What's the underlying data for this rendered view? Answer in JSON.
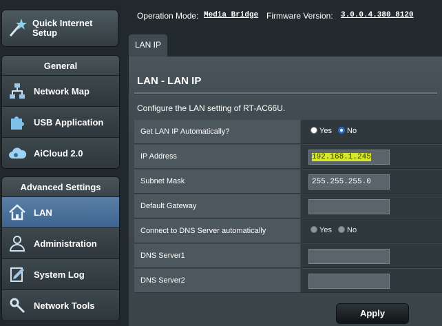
{
  "sidebar": {
    "quick_setup_label": "Quick Internet Setup",
    "general": {
      "title": "General",
      "items": [
        {
          "label": "Network Map",
          "icon": "network-map-icon"
        },
        {
          "label": "USB Application",
          "icon": "puzzle-icon"
        },
        {
          "label": "AiCloud 2.0",
          "icon": "cloud-icon"
        }
      ]
    },
    "advanced": {
      "title": "Advanced Settings",
      "items": [
        {
          "label": "LAN",
          "icon": "home-icon",
          "active": true
        },
        {
          "label": "Administration",
          "icon": "person-icon"
        },
        {
          "label": "System Log",
          "icon": "log-icon"
        },
        {
          "label": "Network Tools",
          "icon": "wrench-icon"
        }
      ]
    }
  },
  "topbar": {
    "op_mode_label": "Operation Mode:",
    "op_mode_value": "Media Bridge",
    "firmware_label": "Firmware Version:",
    "firmware_value": "3.0.0.4.380_8120"
  },
  "tabs": [
    {
      "label": "LAN IP",
      "active": true
    }
  ],
  "panel": {
    "title": "LAN - LAN IP",
    "description": "Configure the LAN setting of RT-AC66U.",
    "fields": {
      "auto_ip": {
        "label": "Get LAN IP Automatically?",
        "yes": "Yes",
        "no": "No",
        "selected": "No"
      },
      "ip_address": {
        "label": "IP Address",
        "value": "192.168.1.245"
      },
      "subnet_mask": {
        "label": "Subnet Mask",
        "value": "255.255.255.0"
      },
      "default_gateway": {
        "label": "Default Gateway",
        "value": ""
      },
      "dns_auto": {
        "label": "Connect to DNS Server automatically",
        "yes": "Yes",
        "no": "No"
      },
      "dns1": {
        "label": "DNS Server1",
        "value": ""
      },
      "dns2": {
        "label": "DNS Server2",
        "value": ""
      }
    },
    "apply_label": "Apply"
  },
  "colors": {
    "active_item": "#4a73a0",
    "highlight": "#d8e62a",
    "radio_checked": "#2a6bd8"
  }
}
